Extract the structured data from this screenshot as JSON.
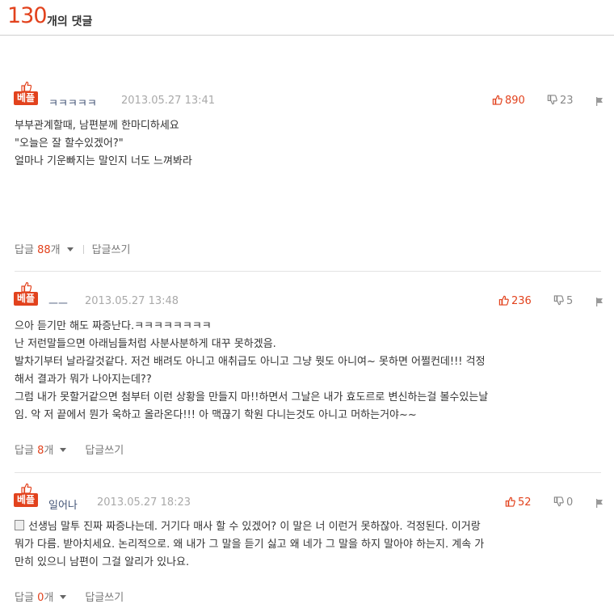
{
  "header": {
    "count": "130",
    "count_label": "개의 댓글"
  },
  "comments": [
    {
      "badge": "베플",
      "author": "ㅋㅋㅋㅋㅋ",
      "date": "2013.05.27 13:41",
      "likes": "890",
      "dislikes": "23",
      "body": [
        "부부관계할때, 남편분께 한마디하세요",
        "",
        "\"오늘은 잘 할수있겠어?\"",
        "",
        "",
        "얼마나 기운빠지는 말인지 너도 느껴봐라"
      ],
      "reply_label": "답글",
      "reply_count": "88",
      "reply_unit": "개",
      "write_reply": "답글쓰기"
    },
    {
      "badge": "베플",
      "author": "ㅡㅡ",
      "date": "2013.05.27 13:48",
      "likes": "236",
      "dislikes": "5",
      "body": [
        "으아 듣기만 해도 짜증난다.ㅋㅋㅋㅋㅋㅋㅋㅋ",
        "난 저런말들으면 아래님들처럼 사분사분하게 대꾸 못하겠음.",
        "발차기부터 날라갈것같다. 저건 배려도 아니고 애취급도 아니고 그냥 뭣도 아니여~ 못하면 어쩔컨데!!! 걱정",
        "해서 결과가 뭐가 나아지는데??",
        "그럼 내가 못할거같으면 첨부터 이런 상황을 만들지 마!!하면서 그날은 내가 효도르로 변신하는걸 볼수있는날",
        "임. 악 저 끝에서 뭔가 욱하고 올라온다!!! 아 맥끊기 학원 다니는것도 아니고 머하는거야~~"
      ],
      "reply_label": "답글",
      "reply_count": "8",
      "reply_unit": "개",
      "write_reply": "답글쓰기"
    },
    {
      "badge": "베플",
      "author": "일어나",
      "date": "2013.05.27 18:23",
      "likes": "52",
      "dislikes": "0",
      "body": [
        "선생님 말투 진짜 짜증나는데. 거기다 매사 할 수 있겠어? 이 말은 너 이런거 못하잖아. 걱정된다. 이거랑",
        "뭐가 다름. 받아치세요. 논리적으로. 왜 내가 그 말을 듣기 싫고 왜 네가 그 말을 하지 말아야 하는지. 계속 가",
        "만히 있으니 남편이 그걸 알리가 있나요."
      ],
      "reply_label": "답글",
      "reply_count": "0",
      "reply_unit": "개",
      "write_reply": "답글쓰기"
    }
  ],
  "colors": {
    "accent": "#e2421d",
    "author": "#445577",
    "muted": "#a9a9a9"
  }
}
